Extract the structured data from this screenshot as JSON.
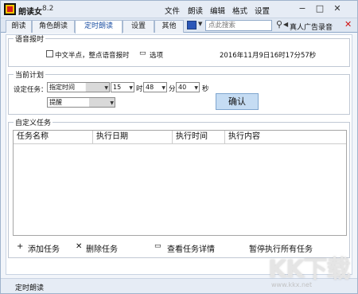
{
  "app": {
    "title": "朗读女",
    "version": "8.2"
  },
  "menu": [
    "文件",
    "朗读",
    "编辑",
    "格式",
    "设置"
  ],
  "tabs": [
    {
      "label": "朗读"
    },
    {
      "label": "角色朗读"
    },
    {
      "label": "定时朗读",
      "active": true
    },
    {
      "label": "设置"
    },
    {
      "label": "其他"
    }
  ],
  "search": {
    "placeholder": "点此搜索"
  },
  "toolbar": {
    "voice_label": "真人广告录音"
  },
  "voice_time": {
    "legend": "语音报时",
    "checkbox_label": "中文半点，整点语音报时",
    "options_label": "选项",
    "current_time": "2016年11月9日16时17分57秒"
  },
  "plan": {
    "legend": "当前计划",
    "task_label": "设定任务：",
    "task_type": "指定时间",
    "hour": "15",
    "hour_unit": "时",
    "minute": "48",
    "minute_unit": "分",
    "second": "40",
    "second_unit": "秒",
    "action": "提醒",
    "confirm": "确认"
  },
  "custom": {
    "legend": "自定义任务",
    "columns": [
      "任务名称",
      "执行日期",
      "执行时间",
      "执行内容"
    ],
    "actions": {
      "add": "添加任务",
      "delete": "删除任务",
      "view": "查看任务详情",
      "pause": "暂停执行所有任务"
    }
  },
  "status": {
    "text": "定时朗读"
  },
  "watermark": {
    "brand": "KK下载",
    "url": "www.kkx.net"
  },
  "colors": {
    "accent": "#1b4fa3",
    "button": "#c5dcf3",
    "close": "#d01010"
  }
}
